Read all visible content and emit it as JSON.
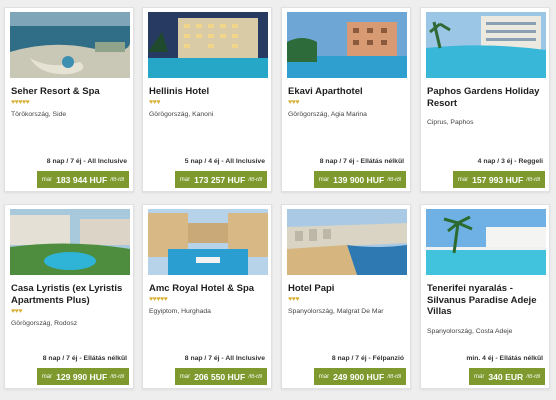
{
  "cards": [
    {
      "title": "Seher Resort & Spa",
      "stars": "♥♥♥♥♥",
      "location": "Törökország, Side",
      "duration": "8 nap / 7 éj - All Inclusive",
      "price_prefix": "már",
      "price": "183 944 HUF",
      "price_suffix": "/fő-től"
    },
    {
      "title": "Hellinis Hotel",
      "stars": "♥♥♥",
      "location": "Görögország, Kanoni",
      "duration": "5 nap / 4 éj - All Inclusive",
      "price_prefix": "már",
      "price": "173 257 HUF",
      "price_suffix": "/fő-től"
    },
    {
      "title": "Ekavi Aparthotel",
      "stars": "♥♥♥",
      "location": "Görögország, Agia Marina",
      "duration": "8 nap / 7 éj - Ellátás nélkül",
      "price_prefix": "már",
      "price": "139 900 HUF",
      "price_suffix": "/fő-től"
    },
    {
      "title": "Paphos Gardens Holiday Resort",
      "stars": "",
      "location": "Ciprus, Paphos",
      "duration": "4 nap / 3 éj - Reggeli",
      "price_prefix": "már",
      "price": "157 993 HUF",
      "price_suffix": "/fő-től"
    },
    {
      "title": "Casa Lyristis (ex Lyristis Apartments Plus)",
      "stars": "♥♥♥",
      "location": "Görögország, Rodosz",
      "duration": "8 nap / 7 éj - Ellátás nélkül",
      "price_prefix": "már",
      "price": "129 990 HUF",
      "price_suffix": "/fő-től"
    },
    {
      "title": "Amc Royal Hotel & Spa",
      "stars": "♥♥♥♥♥",
      "location": "Egyiptom, Hurghada",
      "duration": "8 nap / 7 éj - All Inclusive",
      "price_prefix": "már",
      "price": "206 550 HUF",
      "price_suffix": "/fő-től"
    },
    {
      "title": "Hotel Papi",
      "stars": "♥♥♥",
      "location": "Spanyolország, Malgrat De Mar",
      "duration": "8 nap / 7 éj - Félpanzió",
      "price_prefix": "már",
      "price": "249 900 HUF",
      "price_suffix": "/fő-től"
    },
    {
      "title": "Tenerifei nyaralás - Silvanus Paradise Adeje Villas",
      "stars": "",
      "location": "Spanyolország, Costa Adeje",
      "duration": "min. 4 éj - Ellátás nélkül",
      "price_prefix": "már",
      "price": "340 EUR",
      "price_suffix": "/fő-től"
    }
  ],
  "colors": {
    "accent_green": "#7e9a2e",
    "star_gold": "#d9b13a"
  }
}
